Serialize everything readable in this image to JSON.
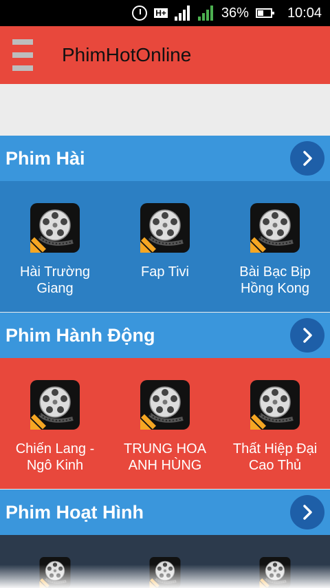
{
  "status": {
    "battery": "36%",
    "time": "10:04",
    "net": "H+",
    "sim_badge_1": "1",
    "sim_badge_2": "2"
  },
  "app": {
    "title": "PhimHotOnline"
  },
  "sections": [
    {
      "title": "Phim Hài",
      "color": "#2c7fc3",
      "items": [
        {
          "label": "Hài Trường Giang"
        },
        {
          "label": "Fap Tivi"
        },
        {
          "label": "Bài Bạc Bịp Hồng Kong"
        }
      ]
    },
    {
      "title": "Phim Hành Động",
      "color": "#e8483c",
      "items": [
        {
          "label": "Chiến Lang - Ngô Kinh"
        },
        {
          "label": "TRUNG HOA ANH HÙNG"
        },
        {
          "label": "Thất Hiệp Đại Cao Thủ"
        }
      ]
    },
    {
      "title": "Phim Hoạt Hình",
      "color": "#2c3a4c",
      "items": [
        {
          "label": ""
        },
        {
          "label": ""
        },
        {
          "label": ""
        }
      ]
    }
  ],
  "colors": {
    "appbar": "#e8483c",
    "section_header": "#3a96dc",
    "arrow_button": "#1e5fa8"
  },
  "icons": {
    "menu": "hamburger-icon",
    "arrow": "chevron-right-icon",
    "movie": "film-reel-icon"
  }
}
